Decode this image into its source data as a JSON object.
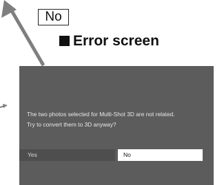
{
  "callout": {
    "label": "No"
  },
  "heading": {
    "text": "Error screen"
  },
  "dialog": {
    "line1": "The two photos selected for Multi-Shot 3D are not related.",
    "line2": "Try to convert them to 3D anyway?",
    "yes_label": "Yes",
    "no_label": "No"
  },
  "colors": {
    "screen_bg": "#5c5c5c",
    "arrow": "#7f7f7f",
    "selected_button": "#ffffff"
  }
}
